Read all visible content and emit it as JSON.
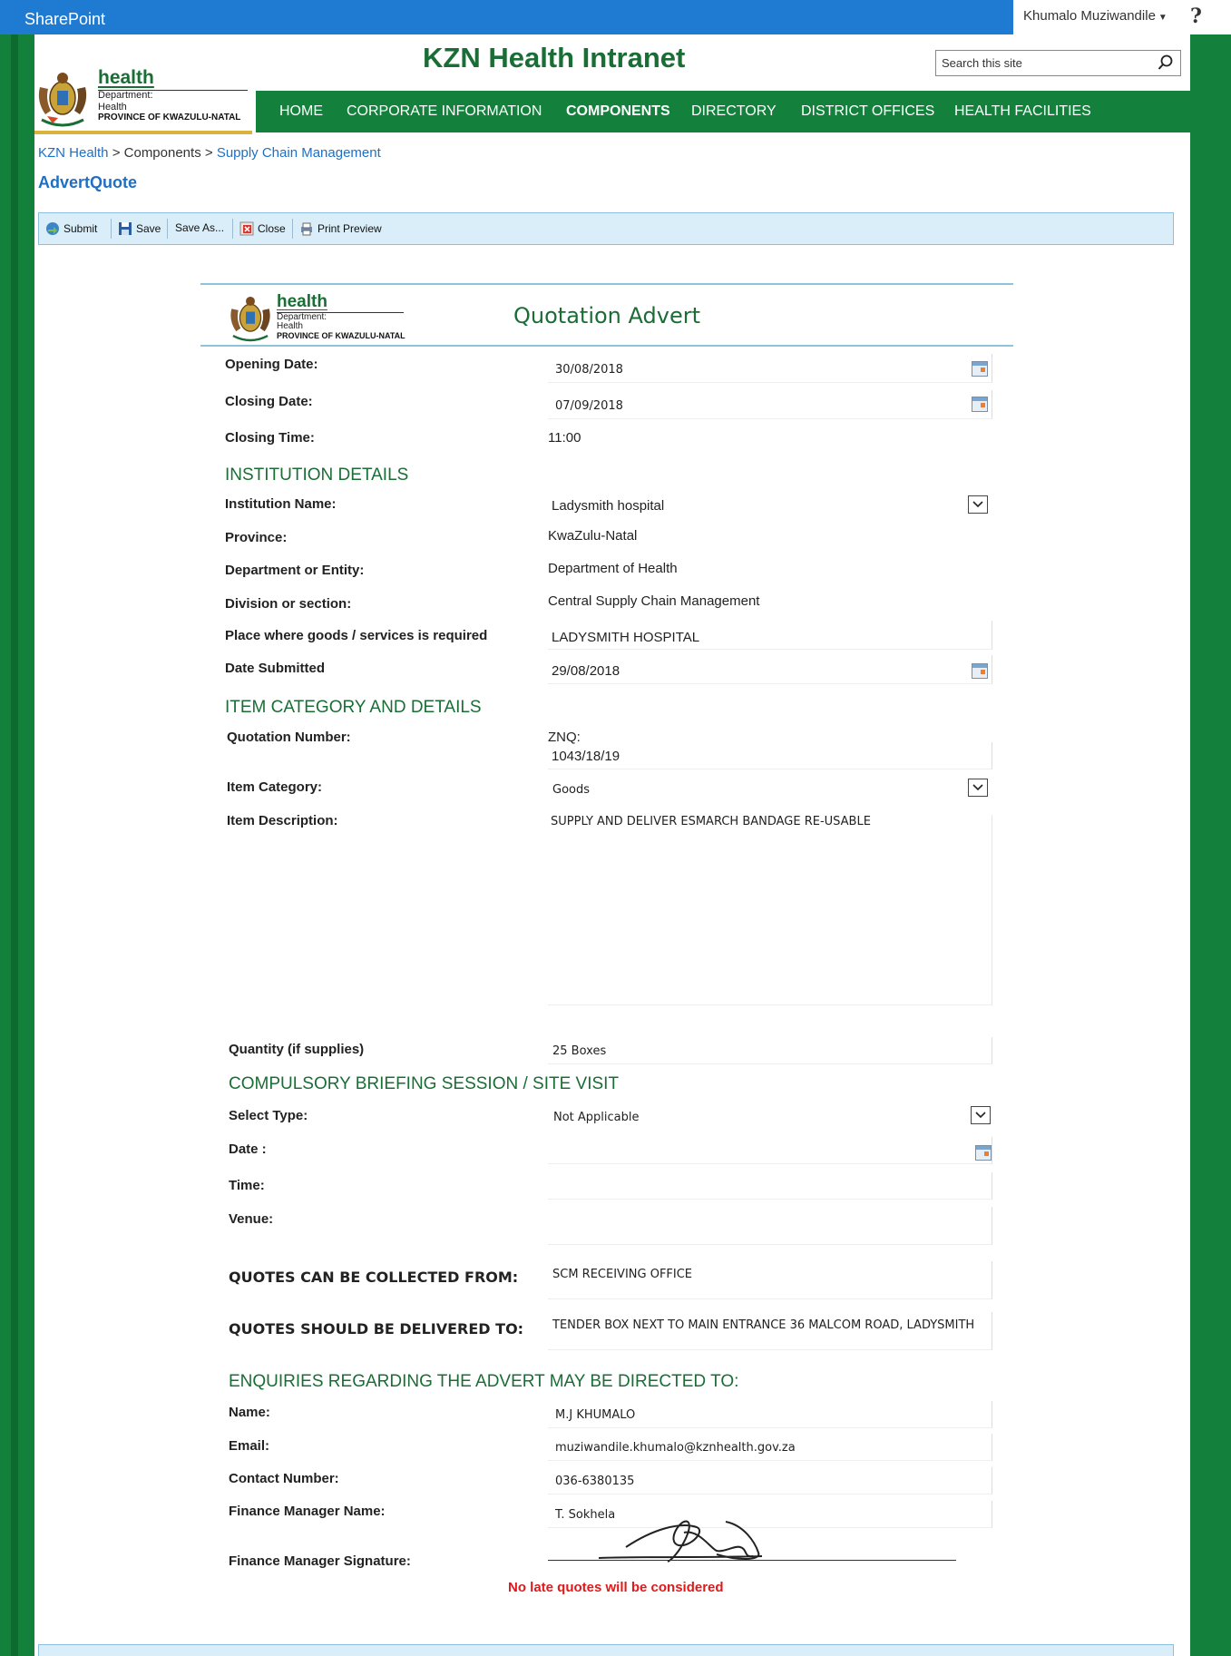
{
  "suite": {
    "title": "SharePoint",
    "user": "Khumalo Muziwandile",
    "help": "?"
  },
  "header": {
    "site_title": "KZN Health Intranet",
    "search_placeholder": "Search this site",
    "logo": {
      "word": "health",
      "dept": "Department:",
      "health": "Health",
      "province": "PROVINCE OF KWAZULU-NATAL"
    }
  },
  "nav": [
    "HOME",
    "CORPORATE INFORMATION",
    "COMPONENTS",
    "DIRECTORY",
    "DISTRICT OFFICES",
    "HEALTH FACILITIES"
  ],
  "nav_active": "COMPONENTS",
  "breadcrumb": {
    "root": "KZN Health",
    "sep1": " > ",
    "mid": "Components",
    "sep2": " > ",
    "leaf": "Supply Chain Management"
  },
  "page_title": "AdvertQuote",
  "toolbar": {
    "submit": "Submit",
    "save": "Save",
    "save_as": "Save As...",
    "close": "Close",
    "print_preview": "Print Preview"
  },
  "form": {
    "title": "Quotation Advert",
    "logo": {
      "word": "health",
      "dept": "Department:",
      "health": "Health",
      "province": "PROVINCE OF KWAZULU-NATAL"
    },
    "opening_date_label": "Opening Date:",
    "opening_date": "30/08/2018",
    "closing_date_label": "Closing Date:",
    "closing_date": "07/09/2018",
    "closing_time_label": "Closing Time:",
    "closing_time": "11:00",
    "institution_section": "INSTITUTION DETAILS",
    "institution_name_label": "Institution Name:",
    "institution_name": "Ladysmith hospital",
    "province_label": "Province:",
    "province": "KwaZulu-Natal",
    "department_label": "Department or Entity:",
    "department": "Department of Health",
    "division_label": "Division or section:",
    "division": "Central Supply Chain Management",
    "place_label": "Place where goods /  services is required",
    "place": "LADYSMITH HOSPITAL",
    "date_submitted_label": "Date Submitted",
    "date_submitted": "29/08/2018",
    "item_section": "ITEM CATEGORY AND DETAILS",
    "quotation_number_label": "Quotation Number:",
    "quotation_number_prefix": "ZNQ:",
    "quotation_number": "1043/18/19",
    "item_category_label": "Item Category:",
    "item_category": "Goods",
    "item_description_label": "Item Description:",
    "item_description": "SUPPLY AND DELIVER ESMARCH BANDAGE RE-USABLE",
    "quantity_label": "Quantity (if supplies)",
    "quantity": "25 Boxes",
    "briefing_section": "COMPULSORY BRIEFING SESSION / SITE VISIT",
    "select_type_label": "Select Type:",
    "select_type": "Not Applicable",
    "briefing_date_label": "Date :",
    "briefing_time_label": "Time:",
    "venue_label": "Venue:",
    "collected_label": "QUOTES CAN BE COLLECTED FROM:",
    "collected": "SCM RECEIVING OFFICE",
    "delivered_label": "QUOTES SHOULD BE DELIVERED TO:",
    "delivered": "TENDER BOX NEXT TO MAIN ENTRANCE 36 MALCOM ROAD, LADYSMITH",
    "enquiries_section": "ENQUIRIES REGARDING THE ADVERT MAY BE DIRECTED TO:",
    "name_label": "Name:",
    "name": "M.J KHUMALO",
    "email_label": "Email:",
    "email": "muziwandile.khumalo@kznhealth.gov.za",
    "contact_label": "Contact Number:",
    "contact": "036-6380135",
    "finance_manager_label": "Finance Manager Name:",
    "finance_manager": "T. Sokhela",
    "signature_label": "Finance Manager Signature:",
    "late_note": "No late quotes will be considered"
  },
  "colors": {
    "suite_blue": "#1f7ad2",
    "brand_green": "#13813b",
    "link_blue": "#1f6fc4",
    "warning_red": "#e0191b"
  }
}
